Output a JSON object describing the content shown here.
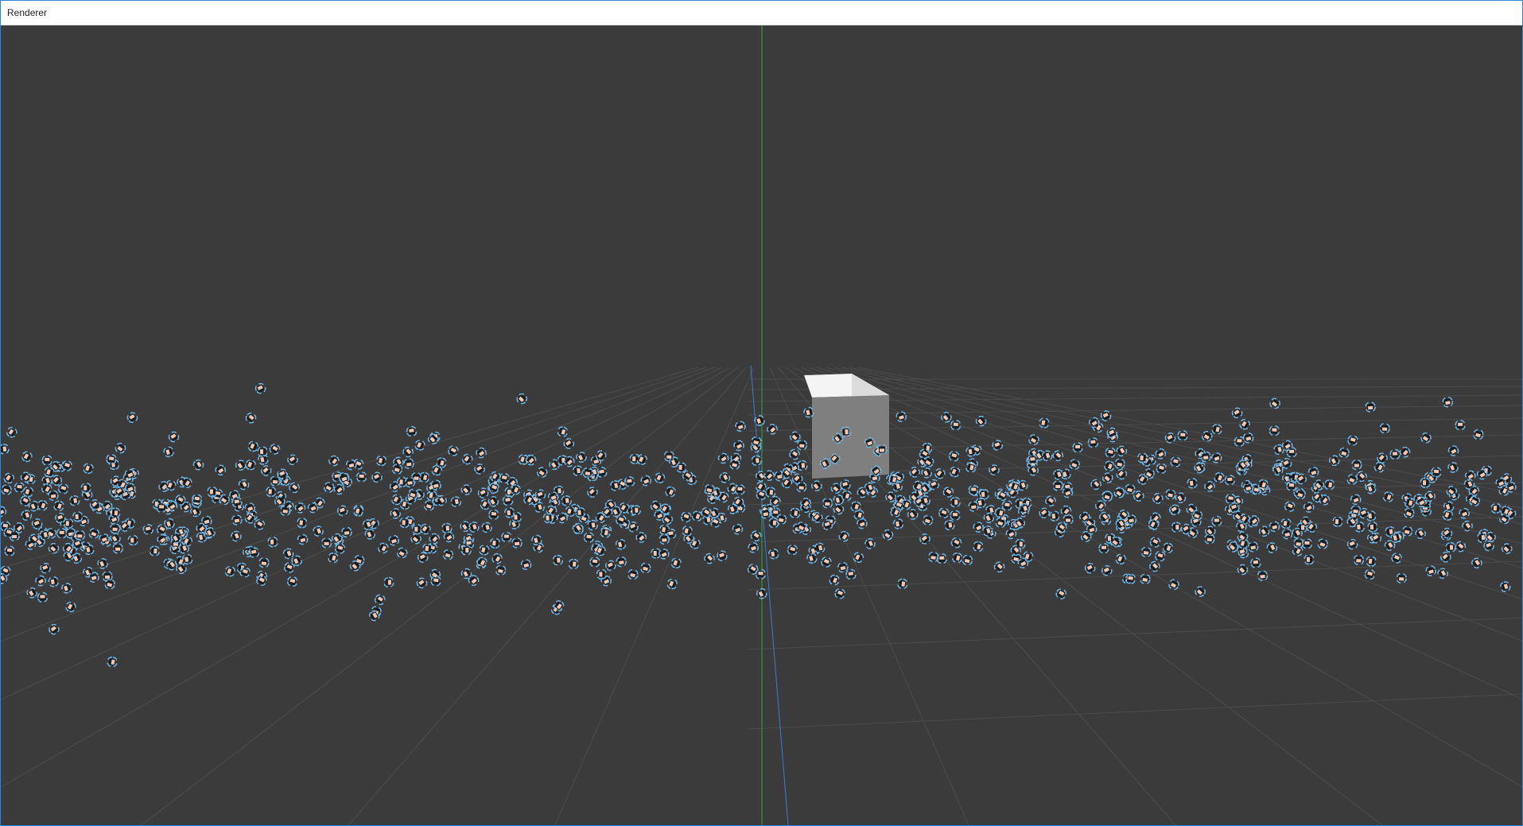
{
  "window": {
    "title": "Renderer"
  },
  "scene": {
    "background_color": "#3b3b3b",
    "grid_color": "#4b4b4b",
    "y_axis_color": "#2faa3a",
    "z_axis_color": "#3a7bd5",
    "cube_color": "#7f7f7f",
    "sprite_outline_color": "#6bb6e8",
    "sprite_face_color": "#f0c8b4",
    "sprite_body_color": "#1b1b1b"
  }
}
